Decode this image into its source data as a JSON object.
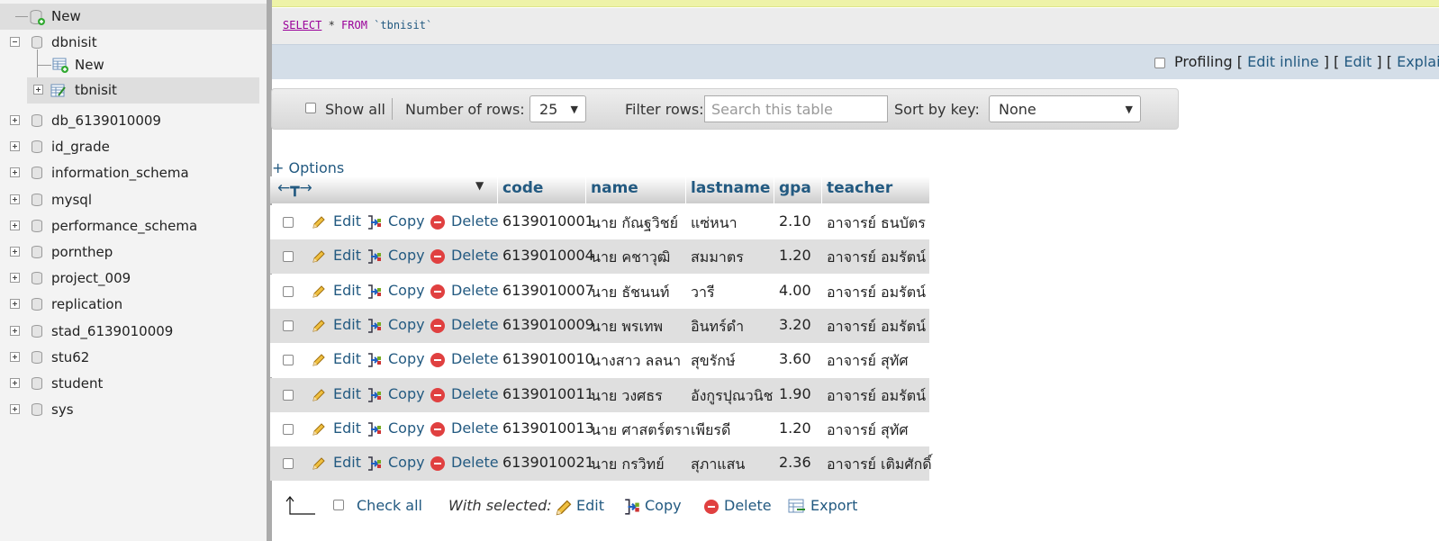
{
  "nav": {
    "new_label": "New",
    "db_open": "dbnisit",
    "db_open_new": "New",
    "db_open_table": "tbnisit",
    "databases": [
      "db_6139010009",
      "id_grade",
      "information_schema",
      "mysql",
      "performance_schema",
      "pornthep",
      "project_009",
      "replication",
      "stad_6139010009",
      "stu62",
      "student",
      "sys"
    ]
  },
  "sql": {
    "kw_select": "SELECT",
    "star": " * ",
    "kw_from": "FROM",
    "table": " `tbnisit`"
  },
  "sqlbar": {
    "profiling": "Profiling",
    "edit_inline": "Edit inline",
    "edit": "Edit",
    "explain": "Explai"
  },
  "navbar": {
    "show_all": "Show all",
    "rows_label": "Number of rows:",
    "rows_value": "25",
    "filter_label": "Filter rows:",
    "filter_placeholder": "Search this table",
    "sort_label": "Sort by key:",
    "sort_value": "None"
  },
  "options_label": "+ Options",
  "table": {
    "headers": [
      "code",
      "name",
      "lastname",
      "gpa",
      "teacher"
    ],
    "actions": {
      "edit": "Edit",
      "copy": "Copy",
      "delete": "Delete"
    },
    "rows": [
      {
        "code": "6139010001",
        "name": "นาย กัณฐวิชย์",
        "lastname": "แซ่หนา",
        "gpa": "2.10",
        "teacher": "อาจารย์ ธนบัตร"
      },
      {
        "code": "6139010004",
        "name": "นาย คชาวุฒิ",
        "lastname": "สมมาตร",
        "gpa": "1.20",
        "teacher": "อาจารย์ อมรัตน์"
      },
      {
        "code": "6139010007",
        "name": "นาย ธัชนนท์",
        "lastname": "วารี",
        "gpa": "4.00",
        "teacher": "อาจารย์ อมรัตน์"
      },
      {
        "code": "6139010009",
        "name": "นาย พรเทพ",
        "lastname": "อินทร์ดำ",
        "gpa": "3.20",
        "teacher": "อาจารย์ อมรัตน์"
      },
      {
        "code": "6139010010",
        "name": "นางสาว ลลนา",
        "lastname": "สุขรักษ์",
        "gpa": "3.60",
        "teacher": "อาจารย์ สุทัศ"
      },
      {
        "code": "6139010011",
        "name": "นาย วงศธร",
        "lastname": "อังกูรปุณวนิช",
        "gpa": "1.90",
        "teacher": "อาจารย์ อมรัตน์"
      },
      {
        "code": "6139010013",
        "name": "นาย ศาสตร์ตรา",
        "lastname": "เพียรดี",
        "gpa": "1.20",
        "teacher": "อาจารย์ สุทัศ"
      },
      {
        "code": "6139010021",
        "name": "นาย กรวิทย์",
        "lastname": "สุภาแสน",
        "gpa": "2.36",
        "teacher": "อาจารย์ เติมศักดิ์"
      }
    ]
  },
  "footer": {
    "check_all": "Check all",
    "with_selected": "With selected:",
    "edit": "Edit",
    "copy": "Copy",
    "delete": "Delete",
    "export": "Export"
  },
  "colors": {
    "link": "#235a81",
    "row_alt": "#dfdfdf",
    "sql_keyword": "#990099"
  }
}
